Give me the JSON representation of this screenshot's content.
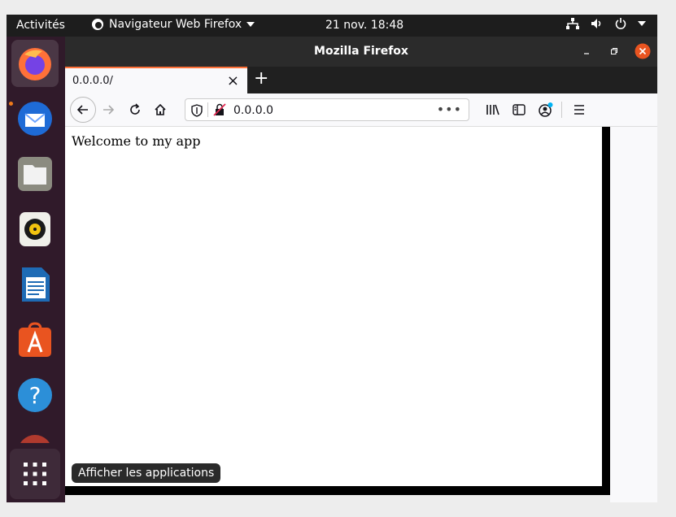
{
  "top_panel": {
    "activities": "Activités",
    "app_menu": "Navigateur Web Firefox",
    "clock": "21 nov.  18:48",
    "icons": [
      "network-icon",
      "volume-icon",
      "power-icon",
      "chevron-down-icon"
    ]
  },
  "window": {
    "title": "Mozilla Firefox",
    "controls": [
      "minimize-icon",
      "restore-icon",
      "close-icon"
    ]
  },
  "tabs": [
    {
      "label": "0.0.0.0/"
    }
  ],
  "new_tab": "+",
  "url_bar": {
    "value": "0.0.0.0",
    "menu": "•••"
  },
  "page": {
    "text": "Welcome to my app"
  },
  "dock": {
    "items": [
      "firefox-icon",
      "thunderbird-icon",
      "files-icon",
      "rhythmbox-icon",
      "libreoffice-writer-icon",
      "software-center-icon",
      "help-icon"
    ],
    "show_apps_tooltip": "Afficher les applications"
  },
  "colors": {
    "top_panel": "#1d1d1d",
    "dock": "#301a2a",
    "accent": "#ff7139",
    "close_button": "#e95420"
  }
}
